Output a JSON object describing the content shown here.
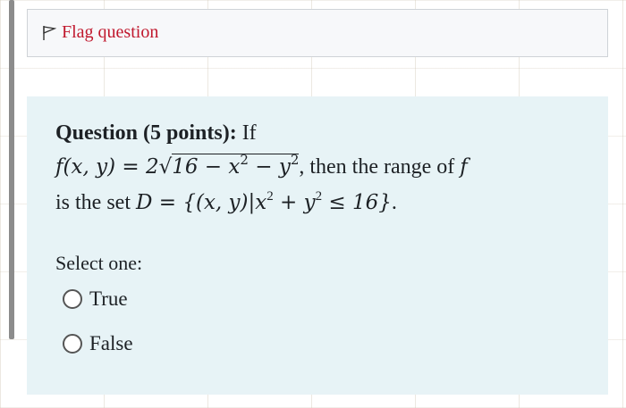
{
  "flag": {
    "label": "Flag question",
    "icon": "flag-icon",
    "color": "#c0182d"
  },
  "question": {
    "header": "Question (5 points):",
    "intro_word": "If",
    "formula_lhs": "f(x, y) = 2",
    "sqrt_base": "16 − x",
    "sqrt_mid": " − y",
    "exp_2": "2",
    "after_formula": ", then the range of ",
    "range_var": "f",
    "line3_prefix": "is the set ",
    "set_expr_a": "D = {(x, y)|x",
    "set_expr_b": " + y",
    "set_expr_c": " ≤ 16}",
    "line3_suffix": "."
  },
  "answer": {
    "prompt": "Select one:",
    "options": [
      "True",
      "False"
    ]
  }
}
